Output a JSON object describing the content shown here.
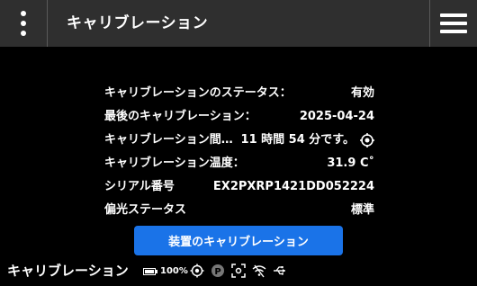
{
  "header": {
    "title": "キャリブレーション"
  },
  "info": {
    "rows": [
      {
        "label": "キャリブレーションのステータス：",
        "value": "有効"
      },
      {
        "label": "最後のキャリブレーション：",
        "value": "2025-04-24"
      },
      {
        "label": "キャリブレーション間…",
        "value": "11 時間 54 分です。"
      },
      {
        "label": "キャリブレーション温度：",
        "value": "31.9 C˚"
      },
      {
        "label": "シリアル番号",
        "value": "EX2PXRP1421DD052224"
      },
      {
        "label": "偏光ステータス",
        "value": "標準"
      }
    ]
  },
  "actions": {
    "calibrate_label": "装置のキャリブレーション"
  },
  "status": {
    "title": "キャリブレーション",
    "battery_percent": 100,
    "battery_label": "100%",
    "icons": [
      "battery-icon",
      "target-icon",
      "p-badge-icon",
      "screenshot-icon",
      "wifi-off-icon",
      "usb-icon"
    ]
  },
  "colors": {
    "topbar": "#2f2f2f",
    "background": "#000000",
    "accent": "#1a73e8"
  }
}
